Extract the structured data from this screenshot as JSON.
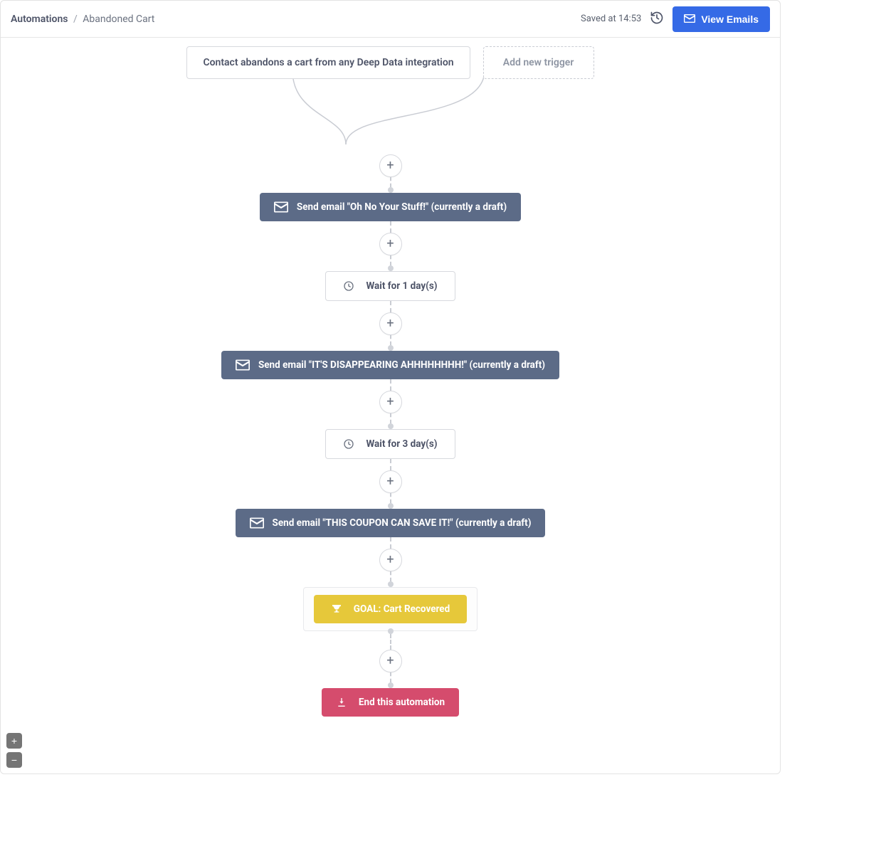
{
  "header": {
    "breadcrumb_root": "Automations",
    "breadcrumb_leaf": "Abandoned Cart",
    "saved_text": "Saved at 14:53",
    "view_emails_label": "View Emails"
  },
  "triggers": {
    "primary_label": "Contact abandons a cart from any Deep Data integration",
    "add_label": "Add new trigger"
  },
  "steps": {
    "email1": "Send email \"Oh No Your Stuff!\" (currently a draft)",
    "wait1": "Wait for 1 day(s)",
    "email2": "Send email \"IT'S DISAPPEARING AHHHHHHHH!\" (currently a draft)",
    "wait2": "Wait for 3 day(s)",
    "email3": "Send email \"THIS COUPON CAN SAVE IT!\" (currently a draft)",
    "goal": "GOAL: Cart Recovered",
    "end": "End this automation"
  },
  "zoom": {
    "in_label": "+",
    "out_label": "−"
  }
}
